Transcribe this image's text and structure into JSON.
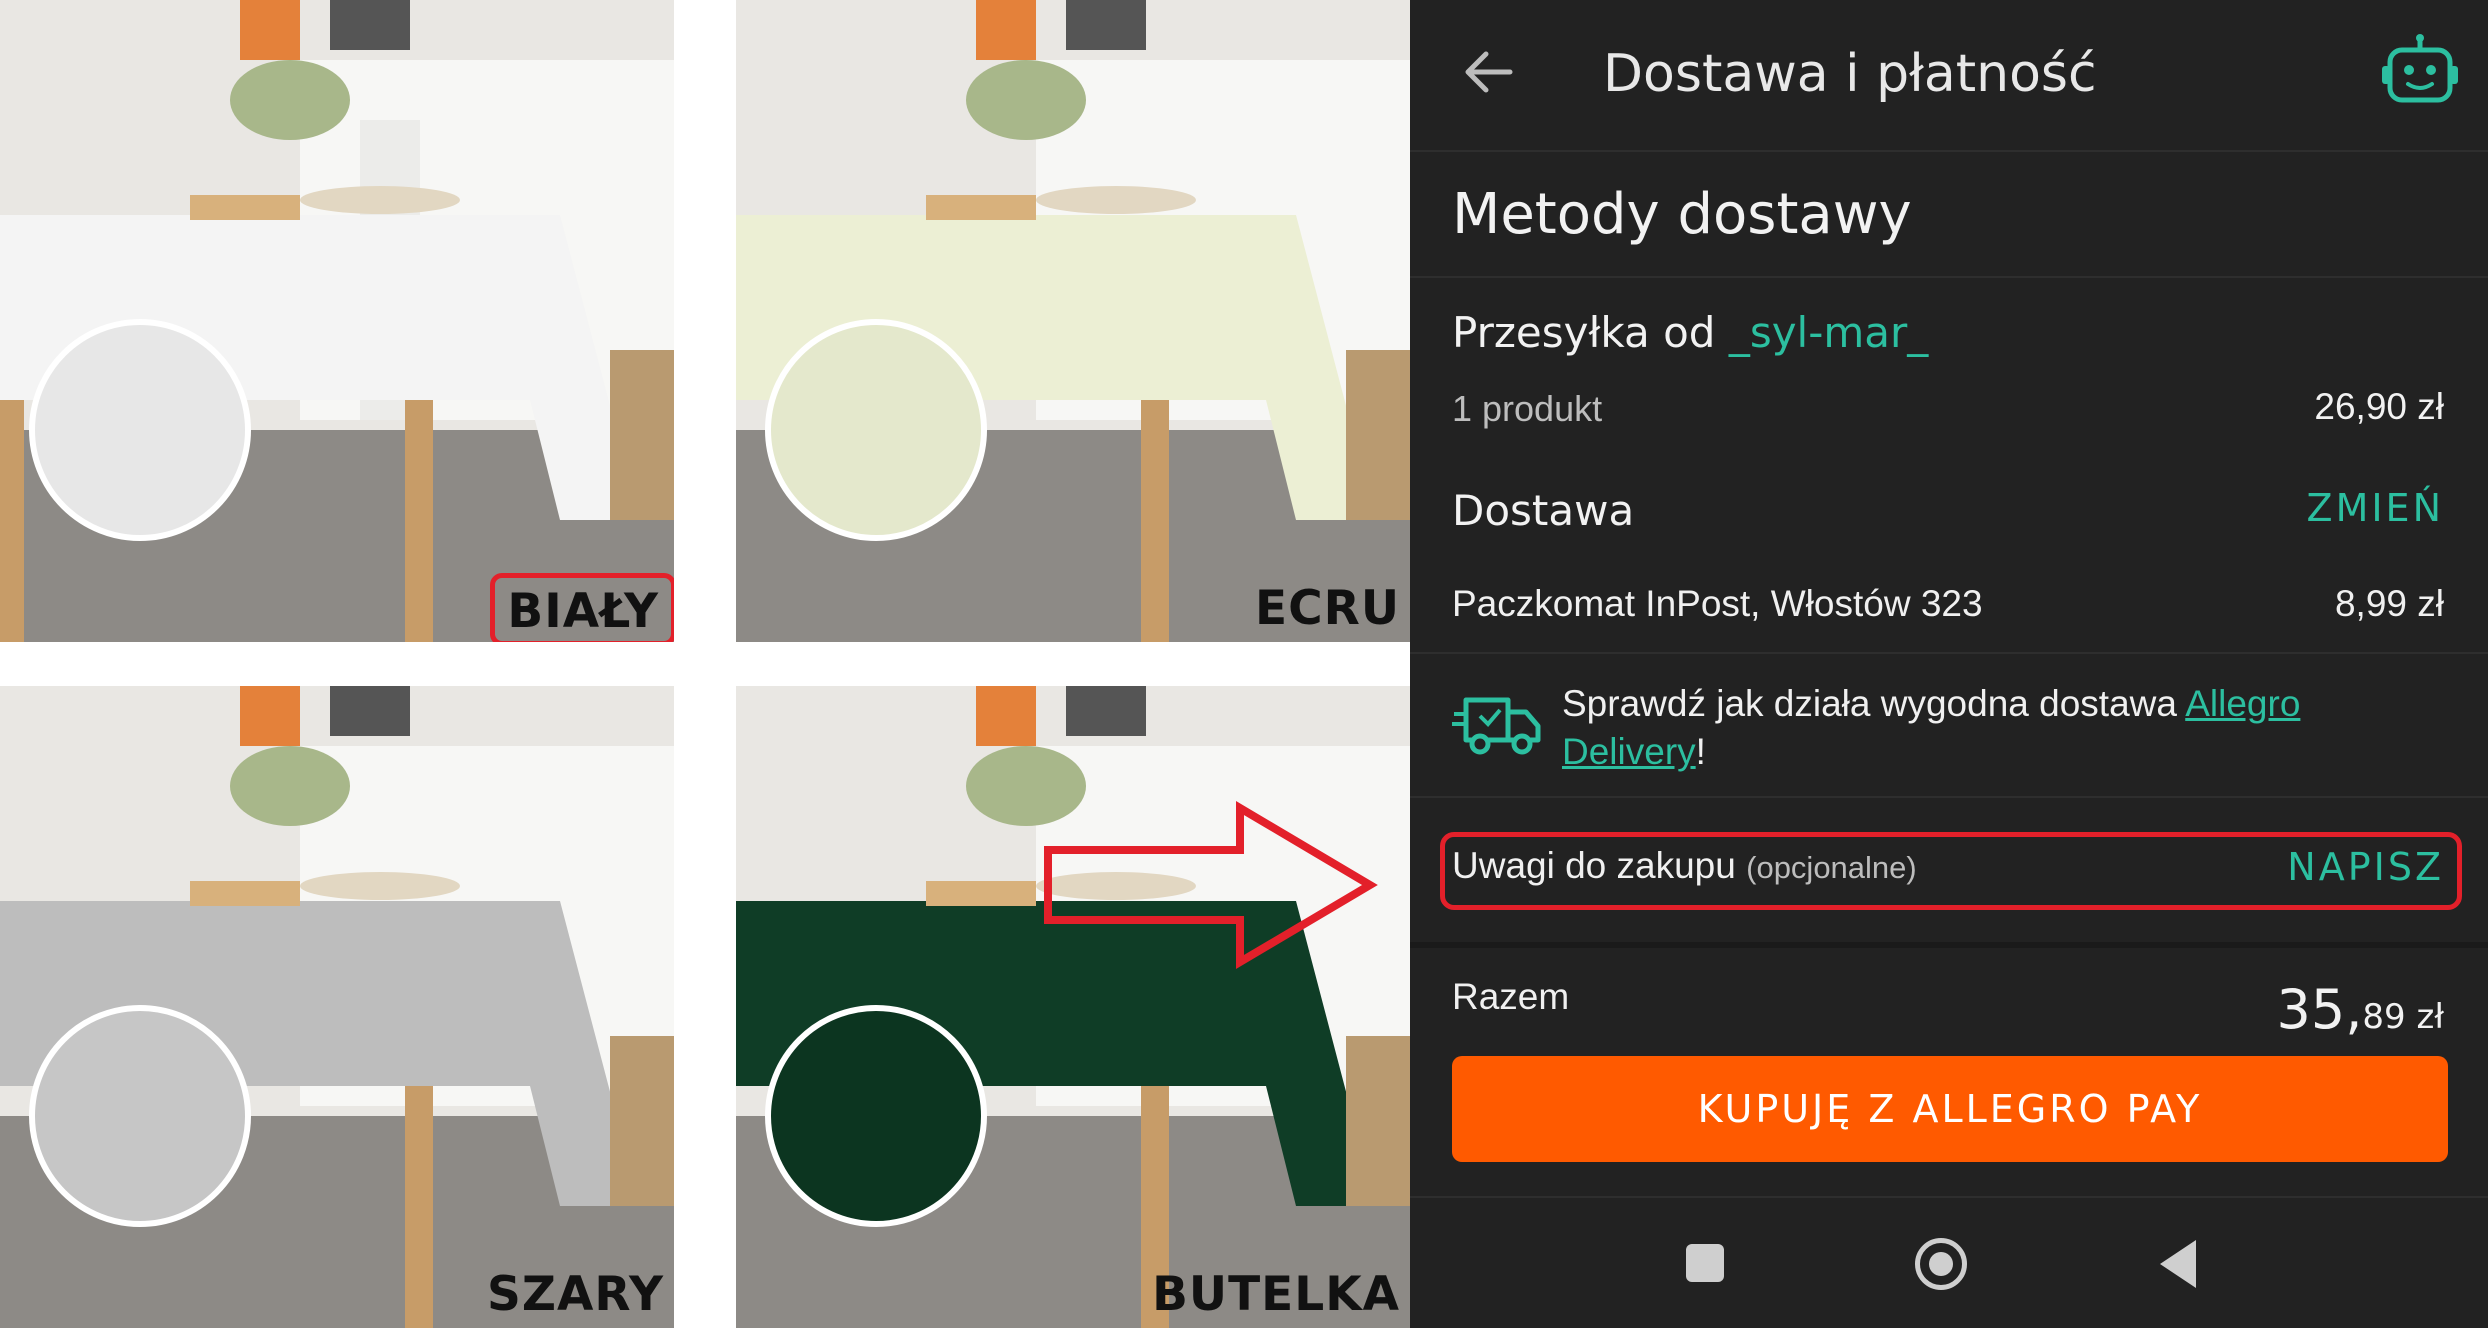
{
  "tiles": [
    {
      "label": "BIAŁY",
      "cloth_color": "#f4f4f4",
      "highlighted": true
    },
    {
      "label": "ECRU",
      "cloth_color": "#ecefd4",
      "highlighted": false
    },
    {
      "label": "SZARY",
      "cloth_color": "#bdbdbd",
      "highlighted": false
    },
    {
      "label": "BUTELKA",
      "cloth_color": "#0f3d26",
      "highlighted": false
    }
  ],
  "checkout": {
    "header_title": "Dostawa i płatność",
    "back_icon": "arrow-left-icon",
    "assistant_icon": "robot-icon",
    "section_title": "Metody dostawy",
    "shipment_prefix": "Przesyłka od",
    "seller": "_syl-mar_",
    "product_count": "1 produkt",
    "product_price": "26,90 zł",
    "delivery_label": "Dostawa",
    "change_label": "ZMIEŃ",
    "delivery_method": "Paczkomat InPost, Włostów 323",
    "delivery_price": "8,99 zł",
    "promo_text": "Sprawdź jak działa wygodna dostawa",
    "promo_link": "Allegro Delivery",
    "promo_suffix": "!",
    "notes_label": "Uwagi do zakupu",
    "notes_optional": "(opcjonalne)",
    "notes_button": "NAPISZ",
    "total_label": "Razem",
    "total_main": "35,",
    "total_cents": "89 zł",
    "pay_button": "KUPUJĘ Z ALLEGRO PAY"
  },
  "colors": {
    "accent": "#2cbfa0",
    "pay": "#ff5a00",
    "highlight": "#e3202a",
    "panel": "#222222"
  }
}
